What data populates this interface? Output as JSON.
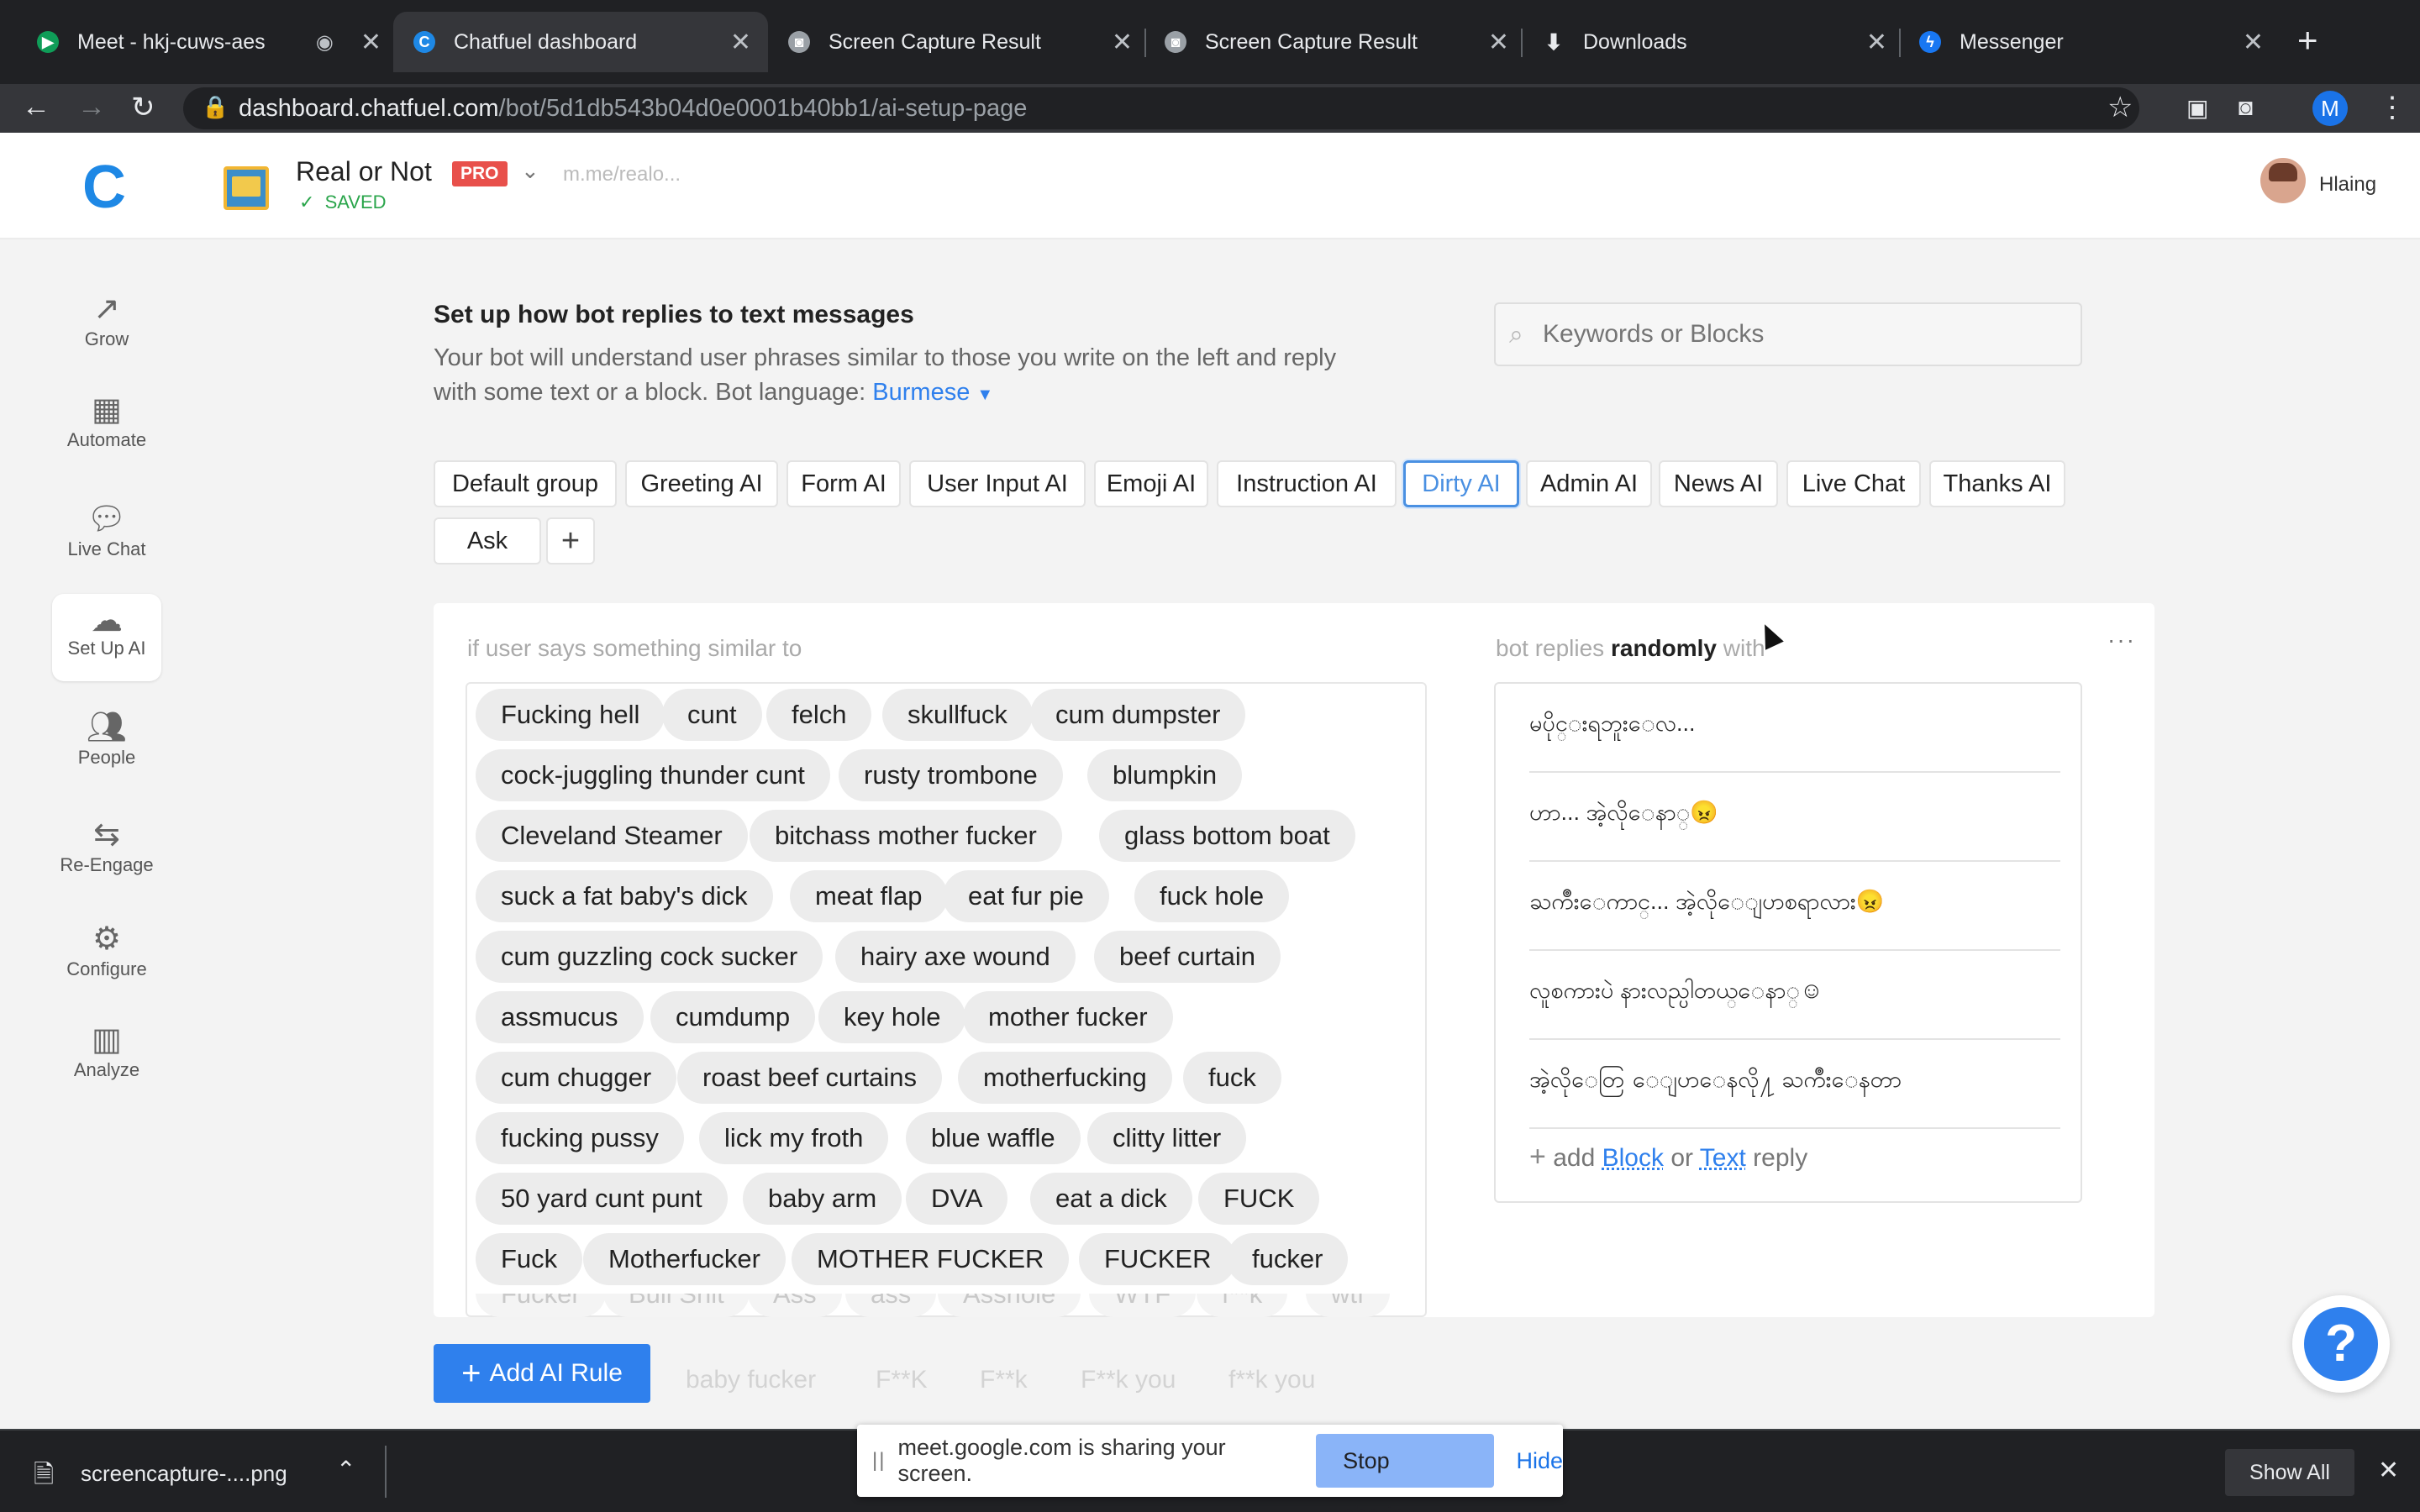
{
  "browser": {
    "tabs": [
      {
        "title": "Meet - hkj-cuws-aes",
        "icon": "meet-icon"
      },
      {
        "title": "Chatfuel dashboard",
        "icon": "chatfuel-icon"
      },
      {
        "title": "Screen Capture Result",
        "icon": "camera-icon"
      },
      {
        "title": "Screen Capture Result",
        "icon": "camera-icon"
      },
      {
        "title": "Downloads",
        "icon": "download-icon"
      },
      {
        "title": "Messenger",
        "icon": "messenger-icon"
      }
    ],
    "url_host": "dashboard.chatfuel.com",
    "url_path": "/bot/5d1db543b04d0e0001b40bb1/ai-setup-page",
    "profile_initial": "M"
  },
  "header": {
    "bot_name": "Real or Not",
    "pro_badge": "PRO",
    "saved_label": "SAVED",
    "page_link": "m.me/realo...",
    "user_name": "Hlaing"
  },
  "sidebar": {
    "items": [
      {
        "label": "Grow"
      },
      {
        "label": "Automate"
      },
      {
        "label": "Live Chat"
      },
      {
        "label": "Set Up AI"
      },
      {
        "label": "People"
      },
      {
        "label": "Re-Engage"
      },
      {
        "label": "Configure"
      },
      {
        "label": "Analyze"
      }
    ]
  },
  "main": {
    "title": "Set up how bot replies to text messages",
    "description": "Your bot will understand user phrases similar to those you write on the left and reply with some text or a block. Bot language:",
    "language": "Burmese",
    "search_placeholder": "Keywords or Blocks",
    "groups": [
      "Default group",
      "Greeting AI",
      "Form AI",
      "User Input AI",
      "Emoji AI",
      "Instruction AI",
      "Dirty AI",
      "Admin AI",
      "News AI",
      "Live Chat",
      "Thanks AI",
      "Ask"
    ],
    "selected_group": "Dirty AI",
    "user_says_label": "if user says something similar to",
    "bot_replies_prefix": "bot replies",
    "bot_replies_mode": "randomly",
    "bot_replies_suffix": "with",
    "phrases": [
      "Fucking hell",
      "cunt",
      "felch",
      "skullfuck",
      "cum dumpster",
      "cock-juggling thunder cunt",
      "rusty trombone",
      "blumpkin",
      "Cleveland Steamer",
      "bitchass mother fucker",
      "glass bottom boat",
      "suck a fat baby's dick",
      "meat flap",
      "eat fur pie",
      "fuck hole",
      "cum guzzling cock sucker",
      "hairy axe wound",
      "beef curtain",
      "assmucus",
      "cumdump",
      "key hole",
      "mother fucker",
      "cum chugger",
      "roast beef curtains",
      "motherfucking",
      "fuck",
      "fucking pussy",
      "lick my froth",
      "blue waffle",
      "clitty litter",
      "50 yard cunt punt",
      "baby arm",
      "DVA",
      "eat a dick",
      "FUCK",
      "Fuck",
      "Motherfucker",
      "MOTHER FUCKER",
      "FUCKER",
      "fucker"
    ],
    "faded_phrases": [
      "Fucker",
      "Bull Shit",
      "Ass",
      "ass",
      "Asshole",
      "WTF",
      "f**k",
      "wtf"
    ],
    "faded_phrases_2": [
      "baby fucker",
      "F**K",
      "F**k",
      "F**k you",
      "f**k you"
    ],
    "replies": [
      "မပိုင္းရဘူးေလ...",
      "ဟာ... အဲ့လိုေနာ္😠",
      "ႀကိဳးေကာင္... အဲ့လိုေျပာစရာလား😠",
      "လူစကားပဲ နားလည္ပါတယ္ေနာ္☺",
      "အဲ့လိုေတြ ေျပာေနလို႔ ႀကိဳးေနတာ"
    ],
    "add_reply_prefix": "add",
    "add_reply_block": "Block",
    "add_reply_or": "or",
    "add_reply_text": "Text",
    "add_reply_suffix": "reply",
    "add_rule_label": "Add AI Rule"
  },
  "share_bar": {
    "message": "meet.google.com is sharing your screen.",
    "stop_label": "Stop sharing",
    "hide_label": "Hide"
  },
  "download_bar": {
    "file_name": "screencapture-....png",
    "show_all_label": "Show All"
  },
  "colors": {
    "accent": "#4a90e2",
    "add_rule_bg": "#2f80ed",
    "pro_badge": "#e8504b",
    "saved_green": "#2aa54b",
    "stop_sharing_bg": "#8ab4f8"
  }
}
